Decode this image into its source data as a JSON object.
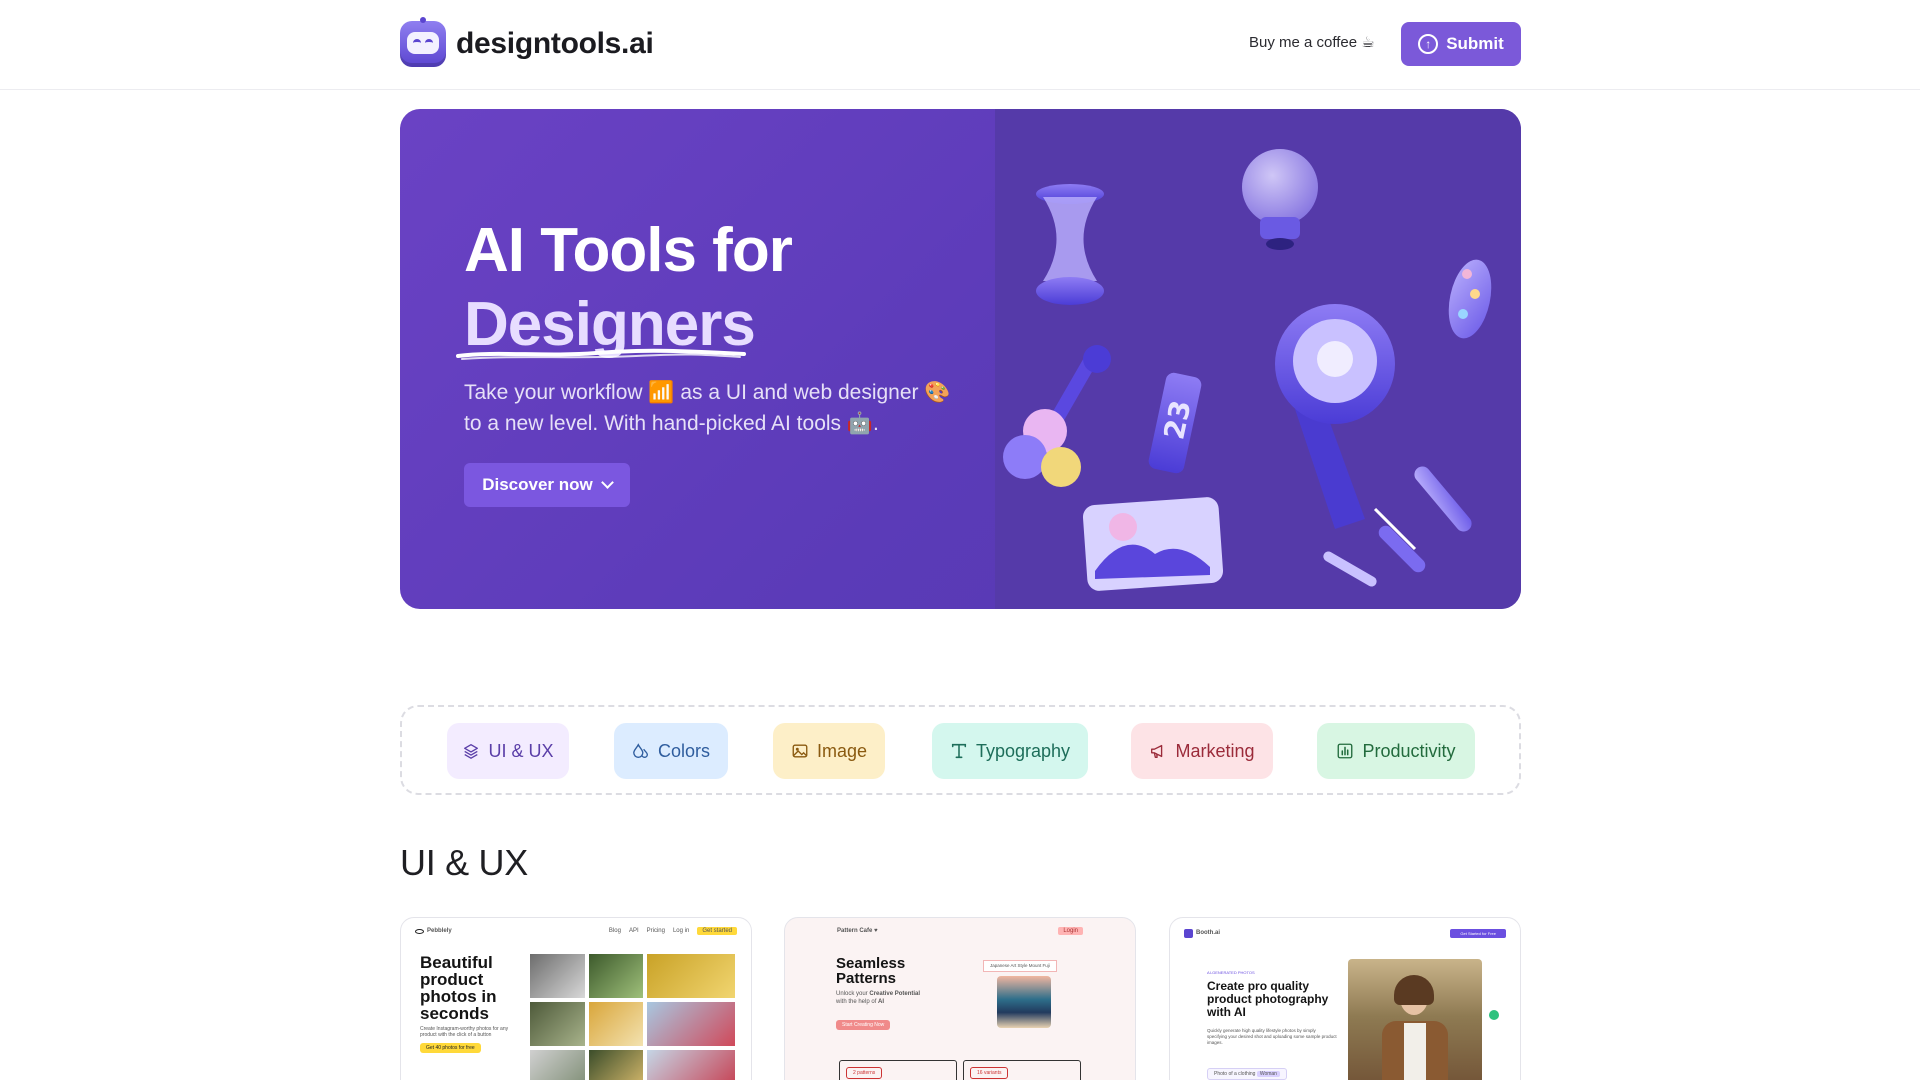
{
  "header": {
    "brand": "designtools.ai",
    "coffee_link": "Buy me a coffee ☕",
    "submit_label": "Submit"
  },
  "hero": {
    "title_line1": "AI Tools for",
    "title_line2": "Designers",
    "subtitle_line1": "Take your workflow 📶 as a UI and web designer 🎨",
    "subtitle_line2": "to a new level. With hand-picked AI tools 🤖.",
    "discover_label": "Discover now"
  },
  "categories": [
    {
      "label": "UI & UX",
      "icon": "layers-icon",
      "bg": "#f3ecff",
      "fg": "#5a3ea8"
    },
    {
      "label": "Colors",
      "icon": "droplets-icon",
      "bg": "#dcecff",
      "fg": "#2f5d9e"
    },
    {
      "label": "Image",
      "icon": "image-icon",
      "bg": "#fdefc8",
      "fg": "#8a5a10"
    },
    {
      "label": "Typography",
      "icon": "type-icon",
      "bg": "#d4f7ee",
      "fg": "#1d6e5a"
    },
    {
      "label": "Marketing",
      "icon": "megaphone-icon",
      "bg": "#fde3e6",
      "fg": "#9b2b3a"
    },
    {
      "label": "Productivity",
      "icon": "chart-icon",
      "bg": "#d8f6e3",
      "fg": "#226b3d"
    }
  ],
  "section": {
    "title": "UI & UX"
  },
  "cards": [
    {
      "brand": "Pebblely",
      "nav": [
        "Blog",
        "API",
        "Pricing",
        "Log in"
      ],
      "nav_cta": "Get started",
      "headline": "Beautiful product photos in seconds",
      "text": "Create Instagram-worthy photos for any product with the click of a button",
      "cta": "Get 40 photos for free"
    },
    {
      "brand": "Pattern Cafe ♥",
      "nav_cta": "Login",
      "headline": "Seamless Patterns",
      "text_a": "Unlock your",
      "text_b": "Creative Potential",
      "text_c": "with the help of",
      "text_d": "AI",
      "cta": "Start Creating Now",
      "prompt": "Japanese Art Style Mount Fuji",
      "tag1": "2 patterns",
      "tag2": "16 variants"
    },
    {
      "brand": "Booth.ai",
      "nav_cta": "Get Started for Free",
      "eyebrow": "AI-GENERATED PHOTOS",
      "headline": "Create pro quality product photography with AI",
      "text": "Quickly generate high quality lifestyle photos by simply specifying your desired shot and uploading some sample product images.",
      "chip": "Photo of a clothing",
      "chip_tag": "Woman"
    }
  ],
  "colors": {
    "accent": "#7b59d9",
    "hero_bg": "#5b3bb8"
  }
}
